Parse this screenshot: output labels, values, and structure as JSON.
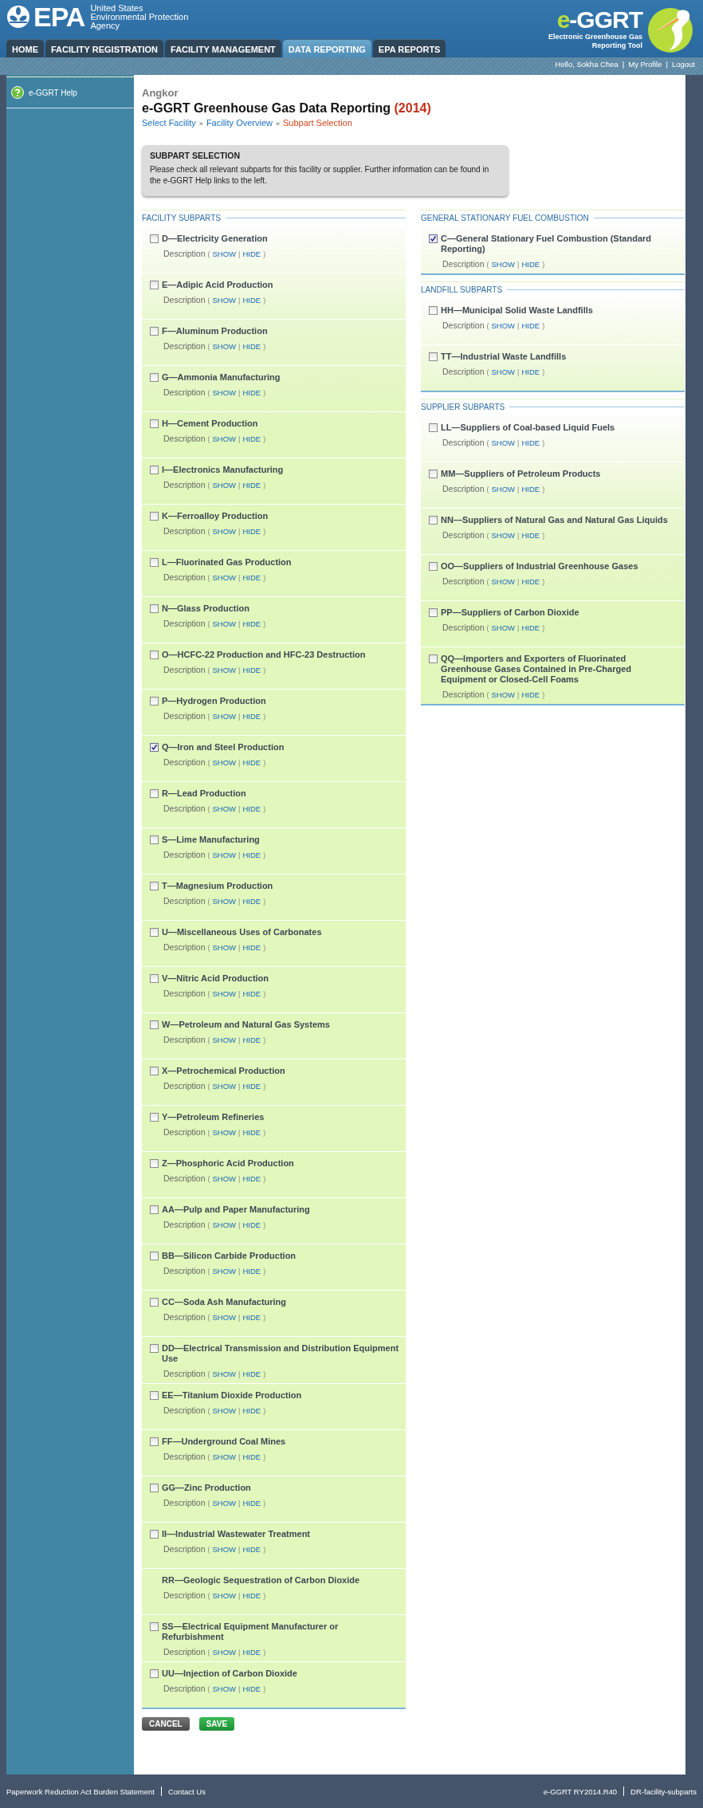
{
  "header": {
    "agency_logo": "EPA",
    "agency_name": [
      "United States",
      "Environmental Protection",
      "Agency"
    ],
    "app_logo": {
      "prefix": "e",
      "rest": "-GGRT"
    },
    "app_name": [
      "Electronic Greenhouse Gas",
      "Reporting Tool"
    ]
  },
  "tabs": [
    {
      "label": "HOME",
      "selected": false
    },
    {
      "label": "FACILITY REGISTRATION",
      "selected": false
    },
    {
      "label": "FACILITY MANAGEMENT",
      "selected": false
    },
    {
      "label": "DATA REPORTING",
      "selected": true
    },
    {
      "label": "EPA REPORTS",
      "selected": false
    }
  ],
  "user_bar": {
    "greeting": "Hello, Sokha Chea",
    "separator": "|",
    "links": [
      "My Profile",
      "Logout"
    ]
  },
  "sidebar": {
    "items": [
      {
        "label": "e-GGRT Help"
      }
    ]
  },
  "page": {
    "facility": "Angkor",
    "title": "e-GGRT Greenhouse Gas Data Reporting",
    "year": "(2014)",
    "separator": "»",
    "breadcrumb": [
      {
        "label": "Select Facility",
        "current": false
      },
      {
        "label": "Facility Overview",
        "current": false
      },
      {
        "label": "Subpart Selection",
        "current": true
      }
    ]
  },
  "notice": {
    "title": "SUBPART SELECTION",
    "text": "Please check all relevant subparts for this facility or supplier. Further information can be found in the e-GGRT Help links to the left."
  },
  "columns": [
    {
      "sections": [
        {
          "title": "FACILITY SUBPARTS",
          "items": [
            {
              "kind": "checkbox",
              "checked": false,
              "label": "D—Electricity Generation",
              "desc": [
                "Description",
                "(",
                "SHOW",
                "|",
                "HIDE",
                ")"
              ]
            },
            {
              "kind": "checkbox",
              "checked": false,
              "label": "E—Adipic Acid Production",
              "desc": [
                "Description",
                "(",
                "SHOW",
                "|",
                "HIDE",
                ")"
              ]
            },
            {
              "kind": "checkbox",
              "checked": false,
              "label": "F—Aluminum Production",
              "desc": [
                "Description",
                "(",
                "SHOW",
                "|",
                "HIDE",
                ")"
              ]
            },
            {
              "kind": "checkbox",
              "checked": false,
              "label": "G—Ammonia Manufacturing",
              "desc": [
                "Description",
                "(",
                "SHOW",
                "|",
                "HIDE",
                ")"
              ]
            },
            {
              "kind": "checkbox",
              "checked": false,
              "label": "H—Cement Production",
              "desc": [
                "Description",
                "(",
                "SHOW",
                "|",
                "HIDE",
                ")"
              ]
            },
            {
              "kind": "checkbox",
              "checked": false,
              "label": "I—Electronics Manufacturing",
              "desc": [
                "Description",
                "(",
                "SHOW",
                "|",
                "HIDE",
                ")"
              ]
            },
            {
              "kind": "checkbox",
              "checked": false,
              "label": "K—Ferroalloy Production",
              "desc": [
                "Description",
                "(",
                "SHOW",
                "|",
                "HIDE",
                ")"
              ]
            },
            {
              "kind": "checkbox",
              "checked": false,
              "label": "L—Fluorinated Gas Production",
              "desc": [
                "Description",
                "(",
                "SHOW",
                "|",
                "HIDE",
                ")"
              ]
            },
            {
              "kind": "checkbox",
              "checked": false,
              "label": "N—Glass Production",
              "desc": [
                "Description",
                "(",
                "SHOW",
                "|",
                "HIDE",
                ")"
              ]
            },
            {
              "kind": "checkbox",
              "checked": false,
              "label": "O—HCFC-22 Production and HFC-23 Destruction",
              "desc": [
                "Description",
                "(",
                "SHOW",
                "|",
                "HIDE",
                ")"
              ]
            },
            {
              "kind": "checkbox",
              "checked": false,
              "label": "P—Hydrogen Production",
              "desc": [
                "Description",
                "(",
                "SHOW",
                "|",
                "HIDE",
                ")"
              ]
            },
            {
              "kind": "checkbox",
              "checked": true,
              "label": "Q—Iron and Steel Production",
              "desc": [
                "Description",
                "(",
                "SHOW",
                "|",
                "HIDE",
                ")"
              ]
            },
            {
              "kind": "checkbox",
              "checked": false,
              "label": "R—Lead Production",
              "desc": [
                "Description",
                "(",
                "SHOW",
                "|",
                "HIDE",
                ")"
              ]
            },
            {
              "kind": "checkbox",
              "checked": false,
              "label": "S—Lime Manufacturing",
              "desc": [
                "Description",
                "(",
                "SHOW",
                "|",
                "HIDE",
                ")"
              ]
            },
            {
              "kind": "checkbox",
              "checked": false,
              "label": "T—Magnesium Production",
              "desc": [
                "Description",
                "(",
                "SHOW",
                "|",
                "HIDE",
                ")"
              ]
            },
            {
              "kind": "checkbox",
              "checked": false,
              "label": "U—Miscellaneous Uses of Carbonates",
              "desc": [
                "Description",
                "(",
                "SHOW",
                "|",
                "HIDE",
                ")"
              ]
            },
            {
              "kind": "checkbox",
              "checked": false,
              "label": "V—Nitric Acid Production",
              "desc": [
                "Description",
                "(",
                "SHOW",
                "|",
                "HIDE",
                ")"
              ]
            },
            {
              "kind": "checkbox",
              "checked": false,
              "label": "W—Petroleum and Natural Gas Systems",
              "desc": [
                "Description",
                "(",
                "SHOW",
                "|",
                "HIDE",
                ")"
              ]
            },
            {
              "kind": "checkbox",
              "checked": false,
              "label": "X—Petrochemical Production",
              "desc": [
                "Description",
                "(",
                "SHOW",
                "|",
                "HIDE",
                ")"
              ]
            },
            {
              "kind": "checkbox",
              "checked": false,
              "label": "Y—Petroleum Refineries",
              "desc": [
                "Description",
                "(",
                "SHOW",
                "|",
                "HIDE",
                ")"
              ]
            },
            {
              "kind": "checkbox",
              "checked": false,
              "label": "Z—Phosphoric Acid Production",
              "desc": [
                "Description",
                "(",
                "SHOW",
                "|",
                "HIDE",
                ")"
              ]
            },
            {
              "kind": "checkbox",
              "checked": false,
              "label": "AA—Pulp and Paper Manufacturing",
              "desc": [
                "Description",
                "(",
                "SHOW",
                "|",
                "HIDE",
                ")"
              ]
            },
            {
              "kind": "checkbox",
              "checked": false,
              "label": "BB—Silicon Carbide Production",
              "desc": [
                "Description",
                "(",
                "SHOW",
                "|",
                "HIDE",
                ")"
              ]
            },
            {
              "kind": "checkbox",
              "checked": false,
              "label": "CC—Soda Ash Manufacturing",
              "desc": [
                "Description",
                "(",
                "SHOW",
                "|",
                "HIDE",
                ")"
              ]
            },
            {
              "kind": "checkbox",
              "checked": false,
              "label": "DD—Electrical Transmission and Distribution Equipment Use",
              "desc": [
                "Description",
                "(",
                "SHOW",
                "|",
                "HIDE",
                ")"
              ]
            },
            {
              "kind": "checkbox",
              "checked": false,
              "label": "EE—Titanium Dioxide Production",
              "desc": [
                "Description",
                "(",
                "SHOW",
                "|",
                "HIDE",
                ")"
              ]
            },
            {
              "kind": "checkbox",
              "checked": false,
              "label": "FF—Underground Coal Mines",
              "desc": [
                "Description",
                "(",
                "SHOW",
                "|",
                "HIDE",
                ")"
              ]
            },
            {
              "kind": "checkbox",
              "checked": false,
              "label": "GG—Zinc Production",
              "desc": [
                "Description",
                "(",
                "SHOW",
                "|",
                "HIDE",
                ")"
              ]
            },
            {
              "kind": "checkbox",
              "checked": false,
              "label": "II—Industrial Wastewater Treatment",
              "desc": [
                "Description",
                "(",
                "SHOW",
                "|",
                "HIDE",
                ")"
              ]
            },
            {
              "kind": "plain",
              "label": "RR—Geologic Sequestration of Carbon Dioxide",
              "desc": [
                "Description",
                "(",
                "SHOW",
                "|",
                "HIDE",
                ")"
              ]
            },
            {
              "kind": "checkbox",
              "checked": false,
              "label": "SS—Electrical Equipment Manufacturer or Refurbishment",
              "desc": [
                "Description",
                "(",
                "SHOW",
                "|",
                "HIDE",
                ")"
              ]
            },
            {
              "kind": "checkbox",
              "checked": false,
              "label": "UU—Injection of Carbon Dioxide",
              "desc": [
                "Description",
                "(",
                "SHOW",
                "|",
                "HIDE",
                ")"
              ]
            }
          ]
        }
      ]
    },
    {
      "sections": [
        {
          "title": "GENERAL STATIONARY FUEL COMBUSTION",
          "items": [
            {
              "kind": "checkbox",
              "checked": true,
              "label": "C—General Stationary Fuel Combustion (Standard Reporting)",
              "desc": [
                "Description",
                "(",
                "SHOW",
                "|",
                "HIDE",
                ")"
              ]
            }
          ]
        },
        {
          "title": "LANDFILL SUBPARTS",
          "items": [
            {
              "kind": "checkbox",
              "checked": false,
              "label": "HH—Municipal Solid Waste Landfills",
              "desc": [
                "Description",
                "(",
                "SHOW",
                "|",
                "HIDE",
                ")"
              ]
            },
            {
              "kind": "checkbox",
              "checked": false,
              "label": "TT—Industrial Waste Landfills",
              "desc": [
                "Description",
                "(",
                "SHOW",
                "|",
                "HIDE",
                ")"
              ]
            }
          ]
        },
        {
          "title": "SUPPLIER SUBPARTS",
          "items": [
            {
              "kind": "checkbox",
              "checked": false,
              "label": "LL—Suppliers of Coal-based Liquid Fuels",
              "desc": [
                "Description",
                "(",
                "SHOW",
                "|",
                "HIDE",
                ")"
              ]
            },
            {
              "kind": "checkbox",
              "checked": false,
              "label": "MM—Suppliers of Petroleum Products",
              "desc": [
                "Description",
                "(",
                "SHOW",
                "|",
                "HIDE",
                ")"
              ]
            },
            {
              "kind": "checkbox",
              "checked": false,
              "label": "NN—Suppliers of Natural Gas and Natural Gas Liquids",
              "desc": [
                "Description",
                "(",
                "SHOW",
                "|",
                "HIDE",
                ")"
              ]
            },
            {
              "kind": "checkbox",
              "checked": false,
              "label": "OO—Suppliers of Industrial Greenhouse Gases",
              "desc": [
                "Description",
                "(",
                "SHOW",
                "|",
                "HIDE",
                ")"
              ]
            },
            {
              "kind": "checkbox",
              "checked": false,
              "label": "PP—Suppliers of Carbon Dioxide",
              "desc": [
                "Description",
                "(",
                "SHOW",
                "|",
                "HIDE",
                ")"
              ]
            },
            {
              "kind": "checkbox",
              "checked": false,
              "label": "QQ—Importers and Exporters of Fluorinated Greenhouse Gases Contained in Pre-Charged Equipment or Closed-Cell Foams",
              "desc": [
                "Description",
                "(",
                "SHOW",
                "|",
                "HIDE",
                ")"
              ]
            }
          ]
        }
      ]
    }
  ],
  "buttons": [
    {
      "kind": "cancel",
      "label": "CANCEL"
    },
    {
      "kind": "save",
      "label": "SAVE"
    }
  ],
  "footer": {
    "left": [
      "Paperwork Reduction Act Burden Statement",
      "Contact Us"
    ],
    "right": [
      "e-GGRT RY2014.R40",
      "DR-facility-subparts"
    ]
  }
}
